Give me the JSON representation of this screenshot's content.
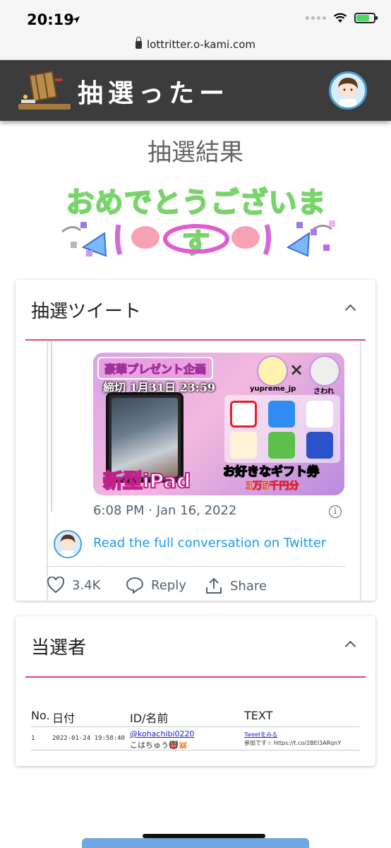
{
  "status_bar": {
    "time": "20:19"
  },
  "browser": {
    "url": "lottritter.o-kami.com"
  },
  "header": {
    "logo_text": "抽選ったー"
  },
  "page_title": "抽選結果",
  "congrats_text": "おめでとうございます",
  "tweet_card": {
    "title": "抽選ツイート",
    "image": {
      "banner": "豪華プレゼント企画",
      "deadline": "締切 1月31日 23:59",
      "collab_left": "yupreme_jp",
      "collab_right": "さわれ",
      "x_mark": "×",
      "product": "新型iPad",
      "gift_label": "お好きなギフト券",
      "amount": "3万5千円分"
    },
    "timestamp": "6:08 PM · Jan 16, 2022",
    "info_symbol": "i",
    "read_link": "Read the full conversation on Twitter",
    "actions": {
      "like_count": "3.4K",
      "reply": "Reply",
      "share": "Share"
    }
  },
  "winners_card": {
    "title": "当選者",
    "columns": [
      "No.",
      "日付",
      "ID/名前",
      "TEXT"
    ],
    "rows": [
      {
        "no": "1",
        "date": "2022-01-24 19:58:40",
        "handle": "@kohachibi0220",
        "name": "こはちゅう👹🐹",
        "tweet_link": "Tweetをみる",
        "text": "参加です☆ https://t.co/2BEI3ARqnY"
      }
    ]
  },
  "colors": {
    "header_bg": "#3c3c3c",
    "accent_rule": "#e0457f",
    "twitter_blue": "#1d9bf0"
  }
}
